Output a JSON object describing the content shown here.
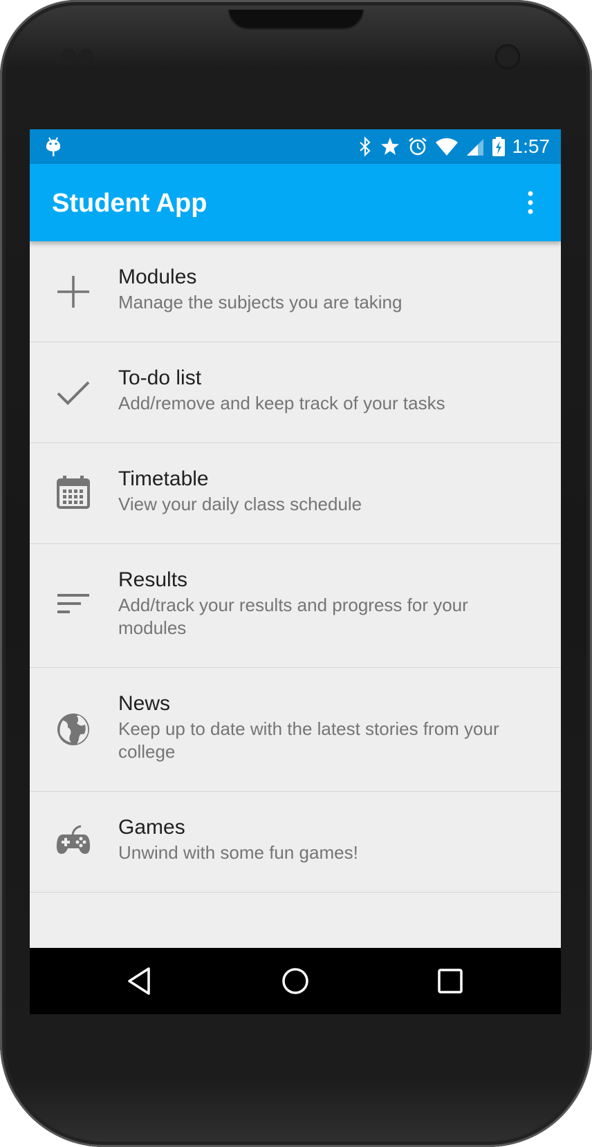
{
  "status_bar": {
    "time": "1:57"
  },
  "app_bar": {
    "title": "Student App"
  },
  "menu": [
    {
      "title": "Modules",
      "subtitle": "Manage the subjects you are taking",
      "icon": "plus-icon"
    },
    {
      "title": "To-do list",
      "subtitle": "Add/remove and keep track of your tasks",
      "icon": "check-icon"
    },
    {
      "title": "Timetable",
      "subtitle": "View your daily class schedule",
      "icon": "calendar-icon"
    },
    {
      "title": "Results",
      "subtitle": "Add/track your results and progress for your modules",
      "icon": "sort-lines-icon"
    },
    {
      "title": "News",
      "subtitle": "Keep up to date with the latest stories from your college",
      "icon": "globe-icon"
    },
    {
      "title": "Games",
      "subtitle": "Unwind with some fun games!",
      "icon": "gamepad-icon"
    }
  ],
  "colors": {
    "status_bar": "#0288d1",
    "app_bar": "#03a9f4",
    "list_bg": "#eeeeee",
    "icon": "#757575"
  }
}
